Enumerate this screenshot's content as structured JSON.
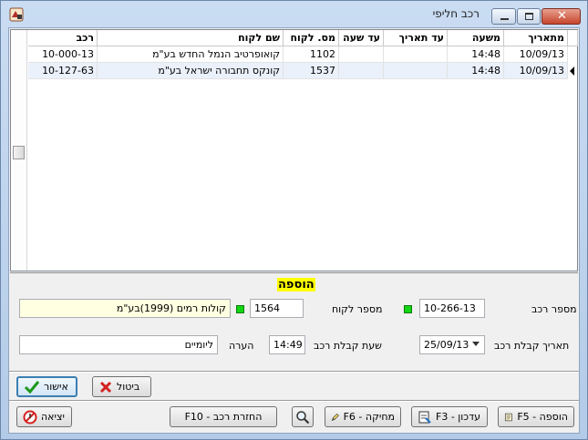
{
  "window": {
    "title": "רכב חליפי"
  },
  "grid": {
    "columns": [
      "מתאריך",
      "משעה",
      "עד תאריך",
      "עד שעה",
      "מס. לקוח",
      "שם לקוח",
      "רכב"
    ],
    "rows": [
      [
        "10/09/13",
        "14:48",
        "",
        "",
        "1102",
        "קואופרטיב הנמל החדש בע\"מ",
        "10-000-13"
      ],
      [
        "10/09/13",
        "14:48",
        "",
        "",
        "1537",
        "קונקס תחבורה ישראל בע\"מ",
        "10-127-63"
      ]
    ]
  },
  "form": {
    "heading": "הוספה",
    "vehicle_label": "מספר רכב",
    "vehicle_value": "10-266-13",
    "customer_label": "מספר לקוח",
    "customer_value": "1564",
    "customer_name": "קולות רמים (1999)בע\"מ",
    "date_label": "תאריך קבלת רכב",
    "date_value": "25/09/13",
    "time_label": "שעת קבלת רכב",
    "time_value": "14:49",
    "note_label": "הערה",
    "note_value": "ליומיים"
  },
  "buttons": {
    "cancel": "ביטול",
    "confirm": "אישור",
    "exit": "יציאה",
    "return": "החזרת רכב - F10",
    "delete": "מחיקה - F6",
    "update": "עדכון - F3",
    "add": "הוספה - F5"
  },
  "colors": {
    "indicator": "#11d611",
    "heading_bg": "#ffff00",
    "selected_row": "#eaf1fb"
  }
}
